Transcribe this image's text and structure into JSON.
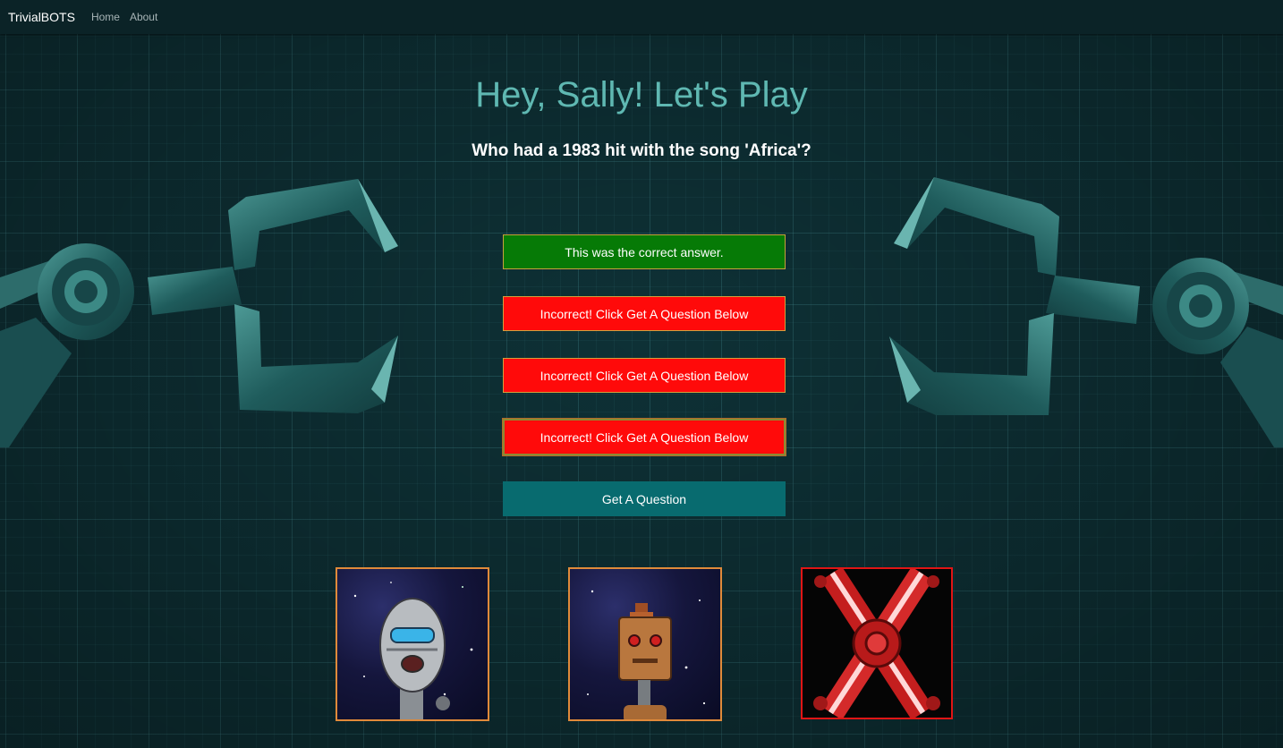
{
  "nav": {
    "brand": "TrivialBOTS",
    "links": [
      "Home",
      "About"
    ]
  },
  "header": {
    "title": "Hey, Sally! Let's Play"
  },
  "question": {
    "text": "Who had a 1983 hit with the song 'Africa'?"
  },
  "answers": [
    {
      "label": "This was the correct answer.",
      "status": "correct"
    },
    {
      "label": "Incorrect! Click Get A Question Below",
      "status": "incorrect"
    },
    {
      "label": "Incorrect! Click Get A Question Below",
      "status": "incorrect"
    },
    {
      "label": "Incorrect! Click Get A Question Below",
      "status": "incorrect"
    }
  ],
  "actions": {
    "get_question": "Get A Question"
  },
  "bots": [
    {
      "icon": "silver-robot-icon",
      "border": "#e08a3a"
    },
    {
      "icon": "bronze-robot-icon",
      "border": "#e08a3a"
    },
    {
      "icon": "red-x-gear-icon",
      "border": "#e01515"
    }
  ],
  "colors": {
    "accent": "#5fb8b2",
    "correct": "#067a06",
    "incorrect": "#ff0a0a",
    "button": "#086b6f"
  }
}
